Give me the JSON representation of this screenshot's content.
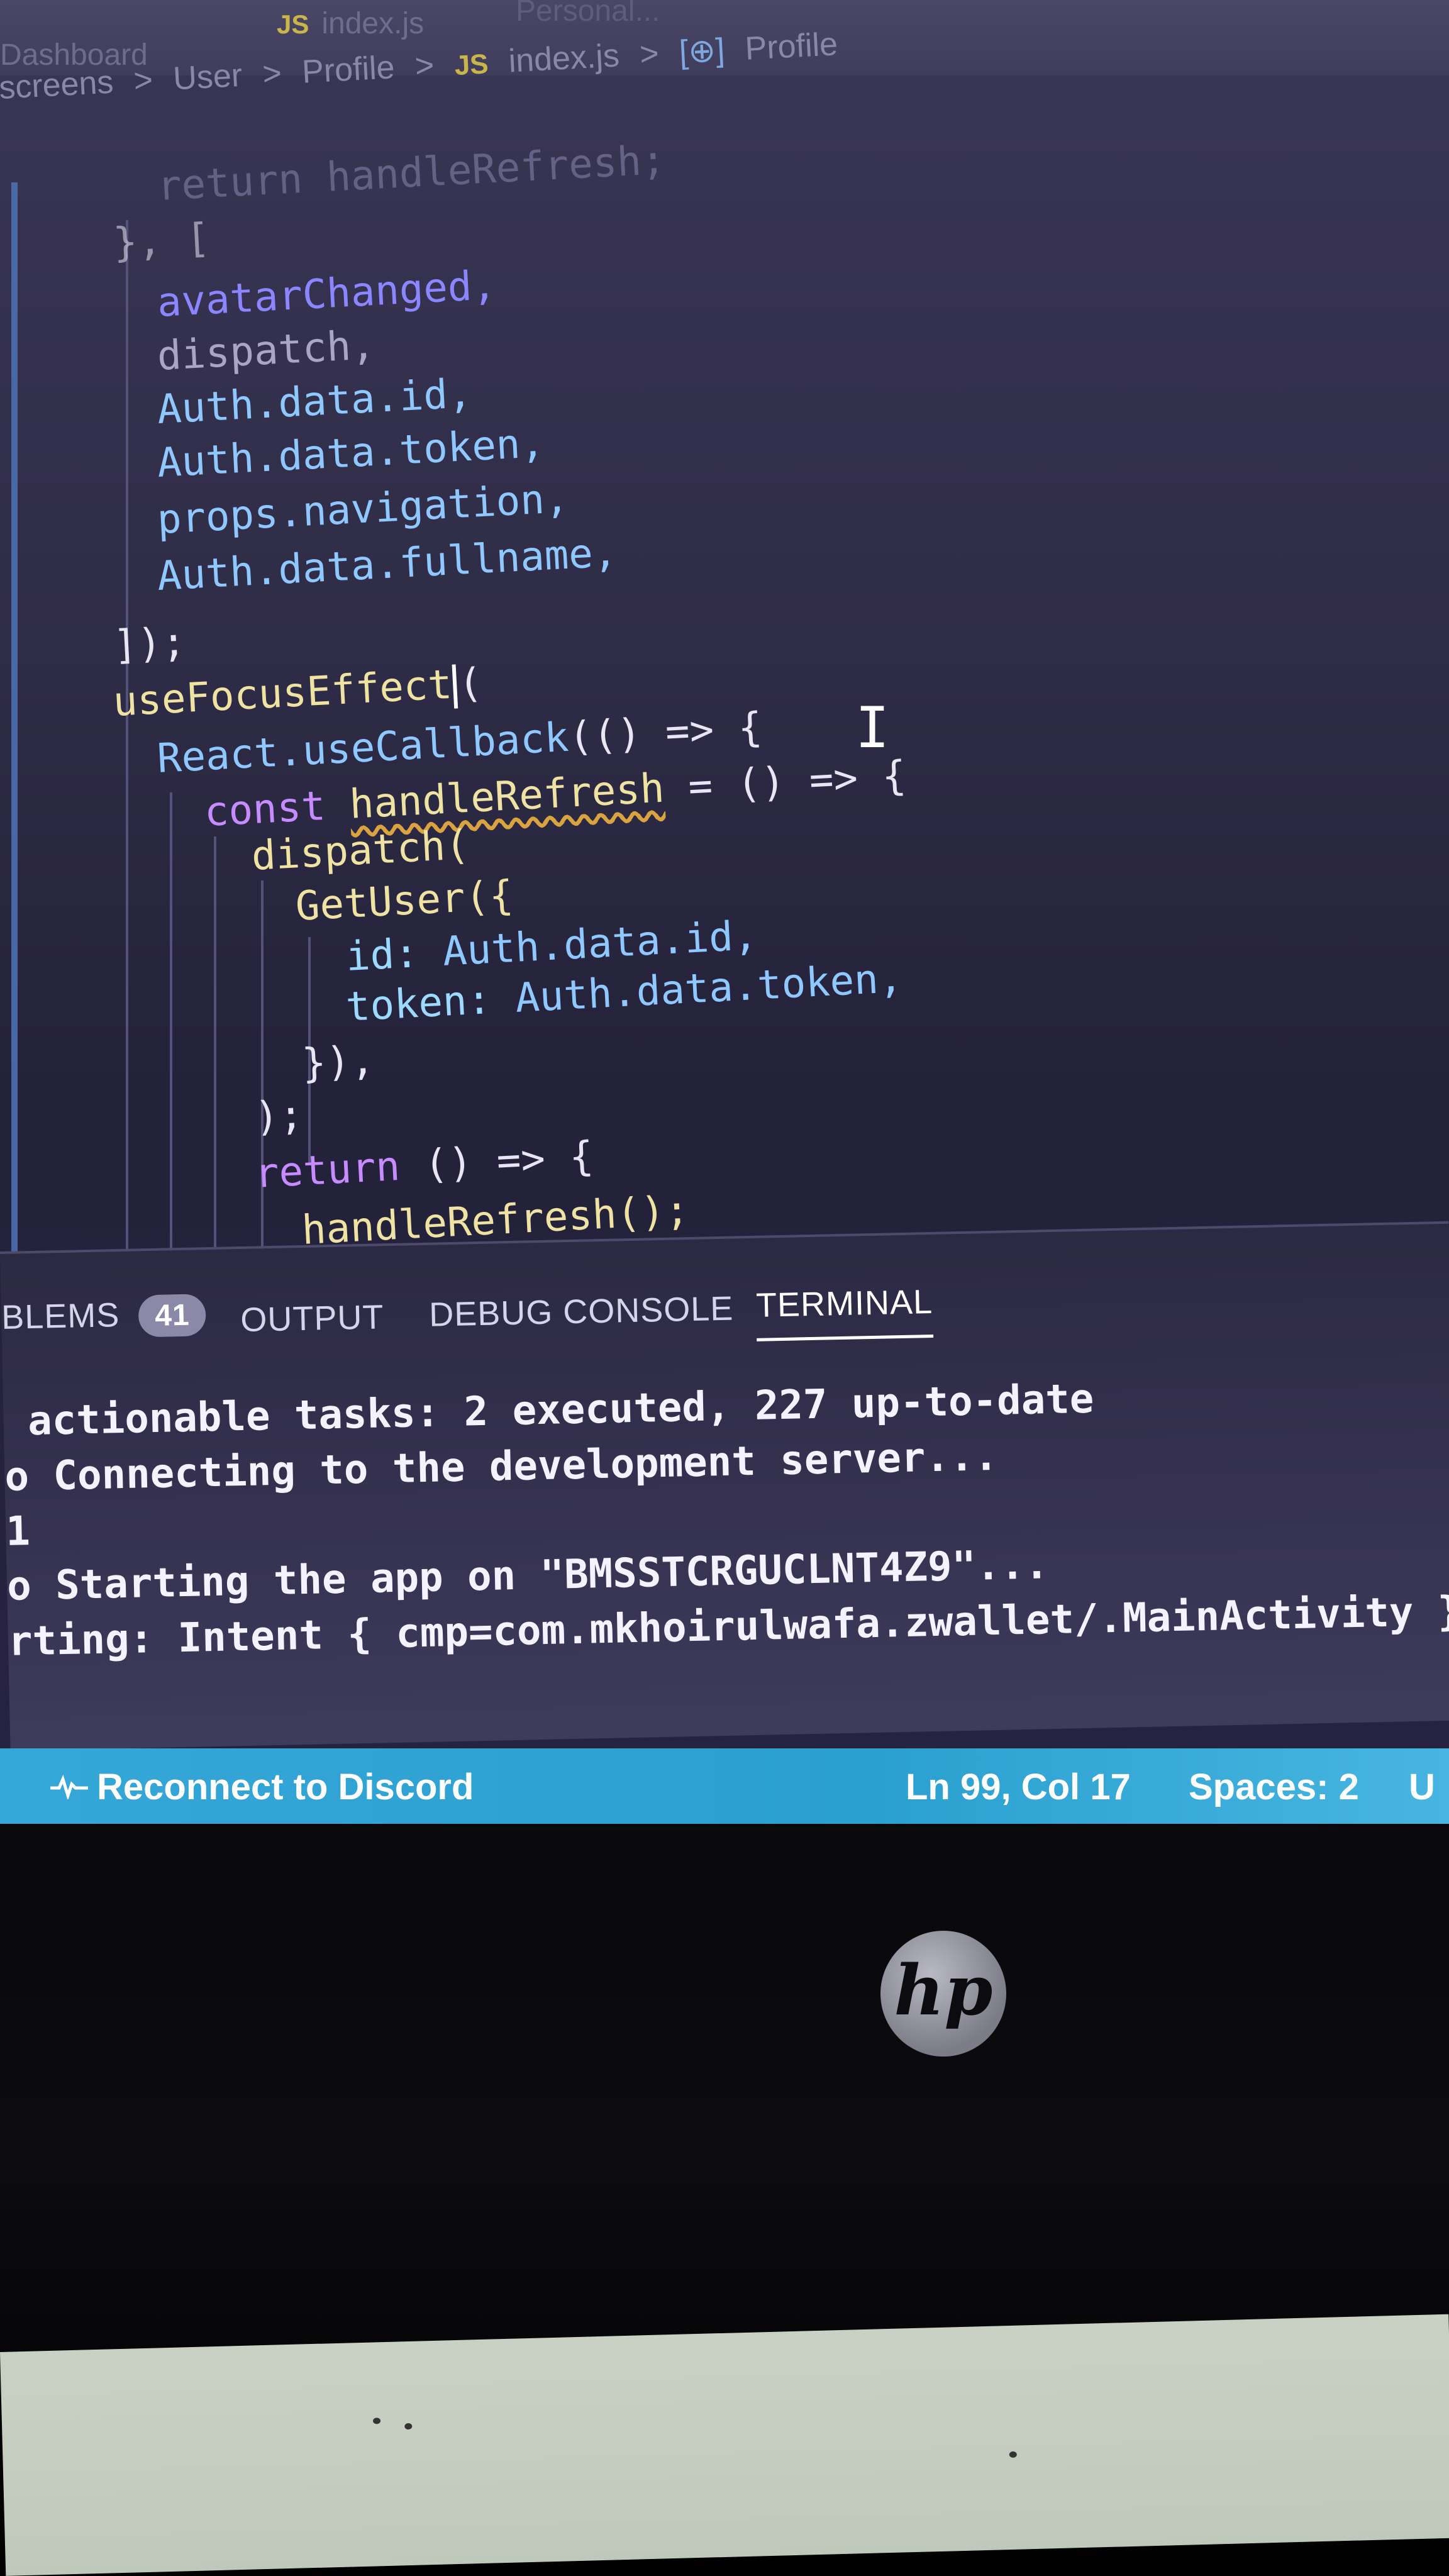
{
  "tabs": {
    "dashboard": "Dashboard",
    "js_badge": "JS",
    "file": "index.js",
    "extra": "Personal..."
  },
  "breadcrumb": [
    "screens",
    ">",
    "User",
    ">",
    "Profile",
    ">",
    "JS",
    "index.js",
    ">",
    "[⊕]",
    "Profile"
  ],
  "code": {
    "l1": "return handleRefresh;",
    "l2": "}, [",
    "l3": "avatarChanged,",
    "l4": "dispatch,",
    "l5": "Auth.data.id,",
    "l6": "Auth.data.token,",
    "l7": "props.navigation,",
    "l8": "Auth.data.fullname,",
    "l9": "]);",
    "l10a": "useFocusEffect",
    "l10b": "(",
    "l11a": "React.useCallback",
    "l11b": "(() => {",
    "l12a": "const ",
    "l12b": "handleRefresh",
    "l12c": " = () => {",
    "l13": "dispatch(",
    "l14": "GetUser({",
    "l15a": "id: ",
    "l15b": "Auth.data.id,",
    "l16a": "token: ",
    "l16b": "Auth.data.token,",
    "l17": "}),",
    "l18": ");",
    "l19a": "return",
    "l19b": " () => {",
    "l20": "handleRefresh();"
  },
  "panel": {
    "problems_label": "BLEMS",
    "problems_count": "41",
    "output_label": "OUTPUT",
    "debug_label": "DEBUG CONSOLE",
    "terminal_label": "TERMINAL"
  },
  "terminal": {
    "line1": " actionable tasks: 2 executed, 227 up-to-date",
    "line2": "o Connecting to the development server...",
    "line3": "1",
    "line4": "o Starting the app on \"BMSSTCRGUCLNT4Z9\"...",
    "line5": "rting: Intent { cmp=com.mkhoirulwafa.zwallet/.MainActivity }"
  },
  "statusbar": {
    "discord": "Reconnect to Discord",
    "position": "Ln 99, Col 17",
    "spaces": "Spaces: 2",
    "encoding": "U"
  },
  "bezel": {
    "logo": "hp"
  },
  "colors": {
    "statusbar": "#35a6d8",
    "editor_bg": "#2f2c47",
    "keyword": "#c68bff",
    "identifier": "#8fc8ff"
  }
}
